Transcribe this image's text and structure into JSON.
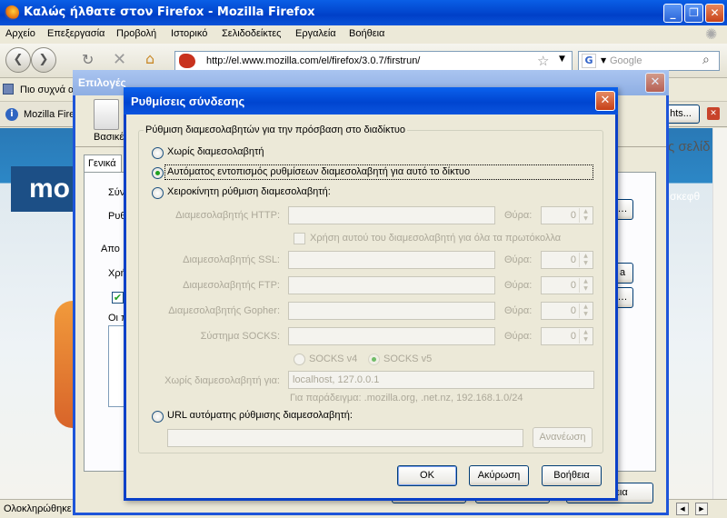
{
  "firefox": {
    "title": "Καλώς ήλθατε στον Firefox - Mozilla Firefox",
    "menu": [
      "Αρχείο",
      "Επεξεργασία",
      "Προβολή",
      "Ιστορικό",
      "Σελιδοδείκτες",
      "Εργαλεία",
      "Βοήθεια"
    ],
    "url": "http://el.www.mozilla.com/el/firefox/3.0.7/firstrun/",
    "search_placeholder": "Google",
    "bookmark_item": "Πιο συχνά α",
    "tab_label": "Mozilla Firef",
    "tab_button": "hts...",
    "page_word": "mo",
    "page_text_right1": "ς σελίδ",
    "page_text_right2": "σκεφθ",
    "status": "Ολοκληρώθηκε"
  },
  "options": {
    "title": "Επιλογές",
    "toolbar_label": "Βασικέ",
    "tab": "Γενικά",
    "labels": [
      "Σύνδ",
      "Ρυθμ",
      "Απο",
      "Χρή",
      "Οι π"
    ],
    "bottom_btn": "Βοήθεια"
  },
  "dialog": {
    "title": "Ρυθμίσεις σύνδεσης",
    "group_label": "Ρύθμιση διαμεσολαβητών για την πρόσβαση στο διαδίκτυο",
    "radio_none": "Χωρίς διαμεσολαβητή",
    "radio_auto": "Αυτόματος εντοπισμός ρυθμίσεων διαμεσολαβητή για αυτό το δίκτυο",
    "radio_manual": "Χειροκίνητη ρύθμιση διαμεσολαβητή:",
    "http_label": "Διαμεσολαβητής HTTP:",
    "port_label": "Θύρα:",
    "same_proxy": "Χρήση αυτού του διαμεσολαβητή για όλα τα πρωτόκολλα",
    "ssl_label": "Διαμεσολαβητής SSL:",
    "ftp_label": "Διαμεσολαβητής FTP:",
    "gopher_label": "Διαμεσολαβητής Gopher:",
    "socks_label": "Σύστημα SOCKS:",
    "port_value": "0",
    "socks_v4": "SOCKS v4",
    "socks_v5": "SOCKS v5",
    "no_proxy_label": "Χωρίς διαμεσολαβητή για:",
    "no_proxy_value": "localhost, 127.0.0.1",
    "example": "Για παράδειγμα: .mozilla.org, .net.nz, 192.168.1.0/24",
    "radio_url": "URL αυτόματης ρύθμισης διαμεσολαβητή:",
    "reload": "Ανανέωση",
    "ok": "OK",
    "cancel": "Ακύρωση",
    "help": "Βοήθεια"
  }
}
